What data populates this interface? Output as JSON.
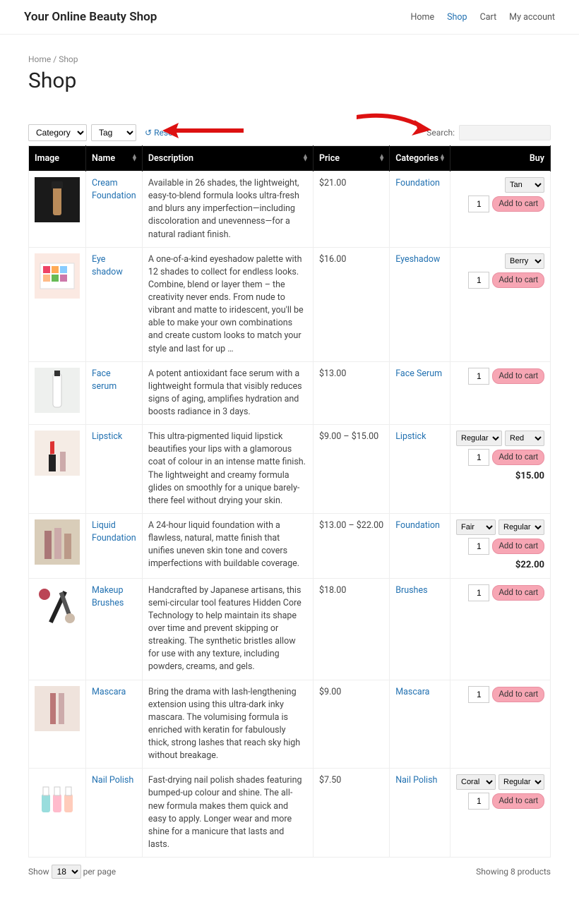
{
  "header": {
    "site_title": "Your Online Beauty Shop",
    "nav": {
      "home": "Home",
      "shop": "Shop",
      "cart": "Cart",
      "account": "My account"
    }
  },
  "breadcrumb": "Home / Shop",
  "page_title": "Shop",
  "toolbar": {
    "category_label": "Category",
    "tag_label": "Tag",
    "reset_label": "Reset",
    "search_label": "Search:"
  },
  "columns": {
    "image": "Image",
    "name": "Name",
    "description": "Description",
    "price": "Price",
    "categories": "Categories",
    "buy": "Buy"
  },
  "products": [
    {
      "name": "Cream Foundation",
      "description": "Available in 26 shades, the lightweight, easy-to-blend formula looks ultra-fresh and blurs any imperfection—including discoloration and unevenness—for a natural radiant finish.",
      "price": "$21.00",
      "category": "Foundation",
      "thumb": "cream-foundation",
      "options": [
        {
          "selected": "Tan"
        }
      ],
      "buy_price": ""
    },
    {
      "name": "Eye shadow",
      "description": "A one-of-a-kind eyeshadow palette with 12 shades to collect for endless looks. Combine, blend or layer them – the creativity never ends. From nude to vibrant and matte to iridescent, you'll be able to make your own combinations and create custom looks to match your style and last for up …",
      "price": "$16.00",
      "category": "Eyeshadow",
      "thumb": "eyeshadow-palette",
      "options": [
        {
          "selected": "Berry"
        }
      ],
      "buy_price": ""
    },
    {
      "name": "Face serum",
      "description": "A potent antioxidant face serum with a lightweight formula that visibly reduces signs of aging, amplifies hydration and boosts radiance in 3 days.",
      "price": "$13.00",
      "category": "Face Serum",
      "thumb": "face-serum",
      "options": [],
      "buy_price": ""
    },
    {
      "name": "Lipstick",
      "description": "This ultra-pigmented liquid lipstick beautifies your lips with a glamorous coat of colour in an intense matte finish. The lightweight and creamy formula glides on smoothly for a unique barely-there feel without drying your skin.",
      "price": "$9.00 – $15.00",
      "category": "Lipstick",
      "thumb": "lipstick",
      "options": [
        {
          "selected": "Regular"
        },
        {
          "selected": "Red"
        }
      ],
      "buy_price": "$15.00"
    },
    {
      "name": "Liquid Foundation",
      "description": "A 24-hour liquid foundation with a flawless, natural, matte finish that unifies uneven skin tone and covers imperfections with buildable coverage.",
      "price": "$13.00 – $22.00",
      "category": "Foundation",
      "thumb": "liquid-foundation",
      "options": [
        {
          "selected": "Fair"
        },
        {
          "selected": "Regular"
        }
      ],
      "buy_price": "$22.00"
    },
    {
      "name": "Makeup Brushes",
      "description": "Handcrafted by Japanese artisans, this semi-circular tool features Hidden Core Technology to help maintain its shape over time and prevent skipping or streaking. The synthetic bristles allow for use with any texture, including powders, creams, and gels.",
      "price": "$18.00",
      "category": "Brushes",
      "thumb": "brushes",
      "options": [],
      "buy_price": ""
    },
    {
      "name": "Mascara",
      "description": "Bring the drama with lash-lengthening extension using this ultra-dark inky mascara. The volumising formula is enriched with keratin for fabulously thick, strong lashes that reach sky high without breakage.",
      "price": "$9.00",
      "category": "Mascara",
      "thumb": "mascara",
      "options": [],
      "buy_price": ""
    },
    {
      "name": "Nail Polish",
      "description": "Fast-drying nail polish shades featuring bumped-up colour and shine. The all-new formula makes them quick and easy to apply. Longer wear and more shine for a manicure that lasts and lasts.",
      "price": "$7.50",
      "category": "Nail Polish",
      "thumb": "nail-polish",
      "options": [
        {
          "selected": "Coral"
        },
        {
          "selected": "Regular"
        }
      ],
      "buy_price": ""
    }
  ],
  "qty_default": "1",
  "add_to_cart_label": "Add to cart",
  "footer": {
    "show_label": "Show",
    "per_page_value": "18",
    "per_page_suffix": "per page",
    "showing_text": "Showing 8 products"
  }
}
